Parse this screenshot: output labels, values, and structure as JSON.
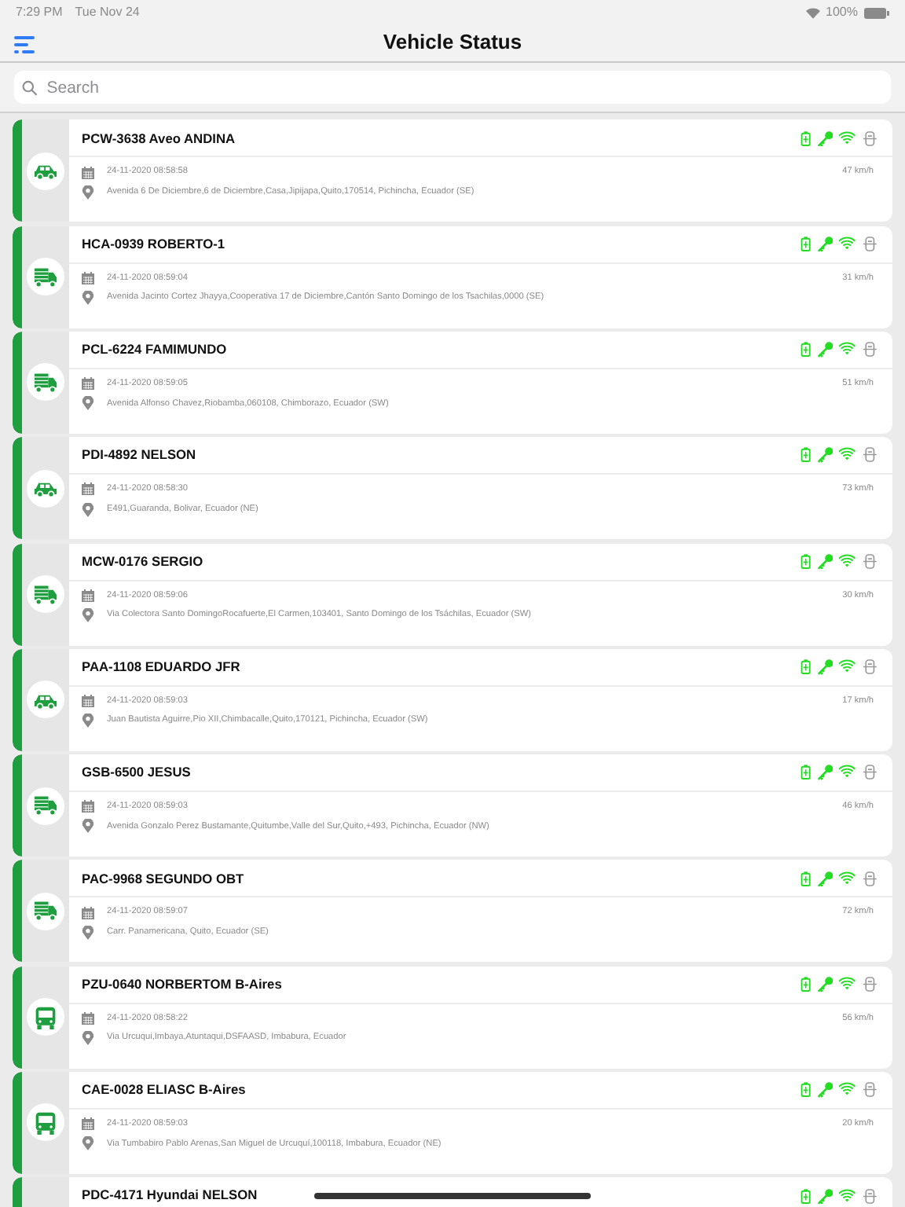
{
  "status_bar": {
    "time": "7:29 PM",
    "date": "Tue Nov 24",
    "battery": "100%"
  },
  "title": "Vehicle Status",
  "search": {
    "placeholder": "Search"
  },
  "vehicles": [
    {
      "name": "PCW-3638 Aveo ANDINA",
      "kind": "car",
      "color": "#1e9e3e",
      "battery_ok": true,
      "ignition_on": true,
      "signal_ok": true,
      "device_on": false,
      "time": "24-11-2020 08:58:58",
      "speed": "47 km/h",
      "address": "Avenida 6 De Diciembre,6 de Diciembre,Casa,Jipijapa,Quito,170514, Pichincha, Ecuador (SE)"
    },
    {
      "name": "HCA-0939 ROBERTO-1",
      "kind": "truck",
      "color": "#1e9e3e",
      "battery_ok": true,
      "ignition_on": true,
      "signal_ok": true,
      "device_on": false,
      "time": "24-11-2020 08:59:04",
      "speed": "31 km/h",
      "address": "Avenida Jacinto Cortez Jhayya,Cooperativa 17 de Diciembre,Cantón Santo Domingo de los Tsachilas,0000 (SE)"
    },
    {
      "name": "PCL-6224 FAMIMUNDO",
      "kind": "truck",
      "color": "#1e9e3e",
      "battery_ok": true,
      "ignition_on": true,
      "signal_ok": true,
      "device_on": false,
      "time": "24-11-2020 08:59:05",
      "speed": "51 km/h",
      "address": "Avenida Alfonso Chavez,Riobamba,060108, Chimborazo, Ecuador (SW)"
    },
    {
      "name": "PDI-4892 NELSON",
      "kind": "car",
      "color": "#1e9e3e",
      "battery_ok": true,
      "ignition_on": true,
      "signal_ok": true,
      "device_on": false,
      "time": "24-11-2020 08:58:30",
      "speed": "73 km/h",
      "address": "E491,Guaranda, Bolivar, Ecuador (NE)"
    },
    {
      "name": "MCW-0176 SERGIO",
      "kind": "truck",
      "color": "#1e9e3e",
      "battery_ok": true,
      "ignition_on": true,
      "signal_ok": true,
      "device_on": false,
      "time": "24-11-2020 08:59:06",
      "speed": "30 km/h",
      "address": "Via Colectora Santo DomingoRocafuerte,El Carmen,103401, Santo Domingo de los Tsáchilas, Ecuador (SW)"
    },
    {
      "name": "PAA-1108 EDUARDO JFR",
      "kind": "car",
      "color": "#1e9e3e",
      "battery_ok": true,
      "ignition_on": true,
      "signal_ok": true,
      "device_on": false,
      "time": "24-11-2020 08:59:03",
      "speed": "17 km/h",
      "address": "Juan Bautista Aguirre,Pio XII,Chimbacalle,Quito,170121, Pichincha, Ecuador (SW)"
    },
    {
      "name": "GSB-6500 JESUS",
      "kind": "truck",
      "color": "#1e9e3e",
      "battery_ok": true,
      "ignition_on": true,
      "signal_ok": true,
      "device_on": false,
      "time": "24-11-2020 08:59:03",
      "speed": "46 km/h",
      "address": "Avenida Gonzalo Perez Bustamante,Quitumbe,Valle del Sur,Quito,+493, Pichincha, Ecuador (NW)"
    },
    {
      "name": "PAC-9968 SEGUNDO OBT",
      "kind": "truck",
      "color": "#1e9e3e",
      "battery_ok": true,
      "ignition_on": true,
      "signal_ok": true,
      "device_on": false,
      "time": "24-11-2020 08:59:07",
      "speed": "72 km/h",
      "address": "Carr. Panamericana, Quito, Ecuador (SE)"
    },
    {
      "name": "PZU-0640 NORBERTOM B-Aires",
      "kind": "bus",
      "color": "#1e9e3e",
      "battery_ok": true,
      "ignition_on": true,
      "signal_ok": true,
      "device_on": false,
      "time": "24-11-2020 08:58:22",
      "speed": "56 km/h",
      "address": "Via Urcuqui,Imbaya,Atuntaqui,DSFAASD, Imbabura, Ecuador"
    },
    {
      "name": "CAE-0028 ELIASC B-Aires",
      "kind": "bus",
      "color": "#1e9e3e",
      "battery_ok": true,
      "ignition_on": true,
      "signal_ok": true,
      "device_on": false,
      "time": "24-11-2020 08:59:03",
      "speed": "20 km/h",
      "address": "Via Tumbabiro  Pablo Arenas,San Miguel de Urcuquí,100118, Imbabura, Ecuador (NE)"
    },
    {
      "name": "PDC-4171 Hyundai NELSON",
      "color": "#1e9e3e",
      "battery_ok": true,
      "ignition_on": true,
      "signal_ok": true,
      "device_on": false
    }
  ]
}
